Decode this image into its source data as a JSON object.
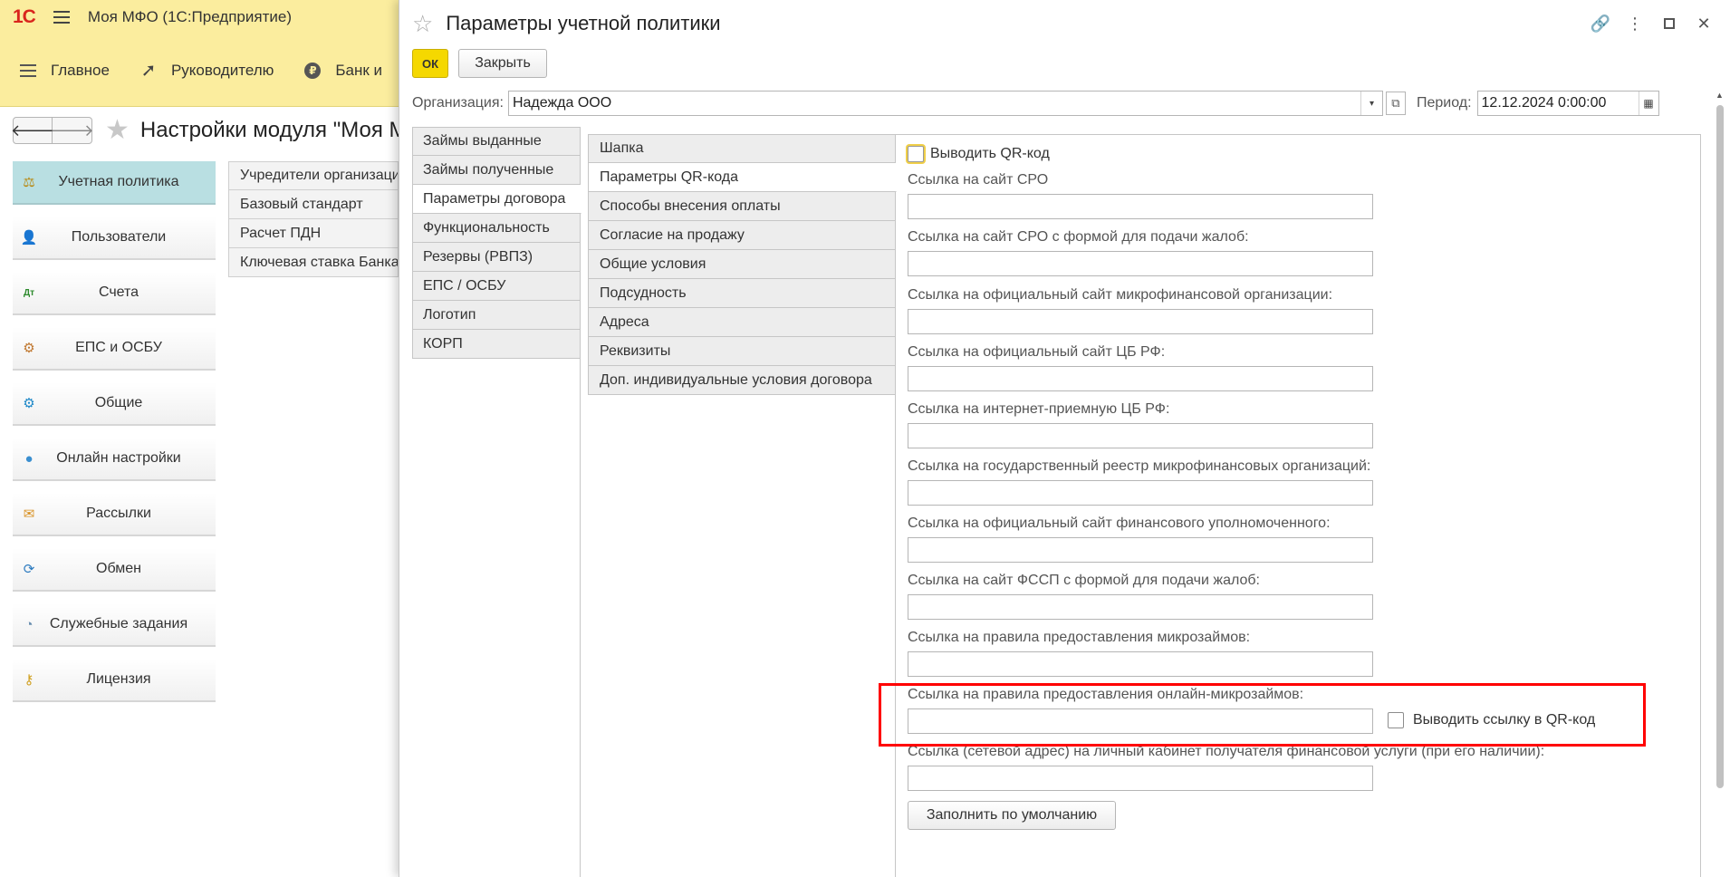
{
  "app": {
    "logo": "1С",
    "title": "Моя МФО  (1С:Предприятие)"
  },
  "sections": [
    {
      "label": "Главное",
      "icon": "menu-lines-icon"
    },
    {
      "label": "Руководителю",
      "icon": "trend-icon"
    },
    {
      "label": "Банк и",
      "icon": "ruble-coin-icon"
    }
  ],
  "nav": {
    "back": "🡐",
    "forward": "🡒",
    "star": "★",
    "page_title": "Настройки модуля \"Моя М"
  },
  "left_nav": [
    {
      "label": "Учетная политика",
      "icon": "⚖",
      "color": "#b8860b",
      "active": true
    },
    {
      "label": "Пользователи",
      "icon": "👤",
      "color": "#8a6a4a",
      "active": false
    },
    {
      "label": "Счета",
      "icon": "Дт",
      "color": "#2e8b2e",
      "active": false
    },
    {
      "label": "ЕПС и ОСБУ",
      "icon": "⚙",
      "color": "#c07830",
      "active": false
    },
    {
      "label": "Общие",
      "icon": "⚙",
      "color": "#1e88c8",
      "active": false
    },
    {
      "label": "Онлайн настройки",
      "icon": "●",
      "color": "#3a8fd0",
      "active": false
    },
    {
      "label": "Рассылки",
      "icon": "✉",
      "color": "#d89020",
      "active": false
    },
    {
      "label": "Обмен",
      "icon": "⟳",
      "color": "#2e7cc0",
      "active": false
    },
    {
      "label": "Служебные задания",
      "icon": "◔",
      "color": "#6a8fb0",
      "active": false
    },
    {
      "label": "Лицензия",
      "icon": "⚷",
      "color": "#d0a020",
      "active": false
    }
  ],
  "bg_list": [
    "Учредители организаци",
    "Базовый стандарт",
    "Расчет ПДН",
    "Ключевая ставка Банка"
  ],
  "dialog": {
    "star": "☆",
    "title": "Параметры учетной политики",
    "controls": {
      "link": "🔗",
      "more": "⋮",
      "close": "✕"
    },
    "ok_label": "ОК",
    "close_label": "Закрыть",
    "org_label": "Организация:",
    "org_value": "Надежда ООО",
    "org_drop": "▾",
    "org_open": "⧉",
    "period_label": "Период:",
    "period_value": "12.12.2024  0:00:00",
    "period_cal": "▦"
  },
  "outer_tabs": [
    {
      "label": "Займы выданные",
      "active": false
    },
    {
      "label": "Займы полученные",
      "active": false
    },
    {
      "label": "Параметры договора",
      "active": true
    },
    {
      "label": "Функциональность",
      "active": false
    },
    {
      "label": "Резервы (РВПЗ)",
      "active": false
    },
    {
      "label": "ЕПС / ОСБУ",
      "active": false
    },
    {
      "label": "Логотип",
      "active": false
    },
    {
      "label": "КОРП",
      "active": false
    }
  ],
  "inner_tabs": [
    {
      "label": "Шапка",
      "active": false
    },
    {
      "label": "Параметры QR-кода",
      "active": true
    },
    {
      "label": "Способы внесения оплаты",
      "active": false
    },
    {
      "label": "Согласие на продажу",
      "active": false
    },
    {
      "label": "Общие условия",
      "active": false
    },
    {
      "label": "Подсудность",
      "active": false
    },
    {
      "label": "Адреса",
      "active": false
    },
    {
      "label": "Реквизиты",
      "active": false
    },
    {
      "label": "Доп. индивидуальные условия договора",
      "active": false
    }
  ],
  "form": {
    "show_qr_label": "Выводить QR-код",
    "fields": [
      {
        "label": "Ссылка на сайт СРО",
        "value": ""
      },
      {
        "label": "Ссылка на сайт СРО с формой для подачи жалоб:",
        "value": ""
      },
      {
        "label": "Ссылка на официальный сайт микрофинансовой организации:",
        "value": ""
      },
      {
        "label": "Ссылка на официальный сайт ЦБ РФ:",
        "value": ""
      },
      {
        "label": "Ссылка на интернет-приемную ЦБ РФ:",
        "value": ""
      },
      {
        "label": "Ссылка на государственный реестр микрофинансовых организаций:",
        "value": ""
      },
      {
        "label": "Ссылка на официальный сайт финансового уполномоченного:",
        "value": ""
      },
      {
        "label": "Ссылка на сайт ФССП с формой для подачи жалоб:",
        "value": ""
      },
      {
        "label": "Ссылка на правила предоставления микрозаймов:",
        "value": ""
      },
      {
        "label": "Ссылка на правила предоставления онлайн-микрозаймов:",
        "value": ""
      },
      {
        "label": "Ссылка (сетевой адрес) на личный кабинет получателя финансовой услуги (при его наличии):",
        "value": ""
      }
    ],
    "inline_checkbox_label": "Выводить ссылку в QR-код",
    "fill_default_label": "Заполнить по умолчанию"
  },
  "scrollbar": {
    "up": "▲"
  },
  "colors": {
    "ok_button": "#f5d800",
    "section_bar": "#fbed9e",
    "active_nav": "#b9dfe2",
    "highlight": "#ff0000"
  }
}
